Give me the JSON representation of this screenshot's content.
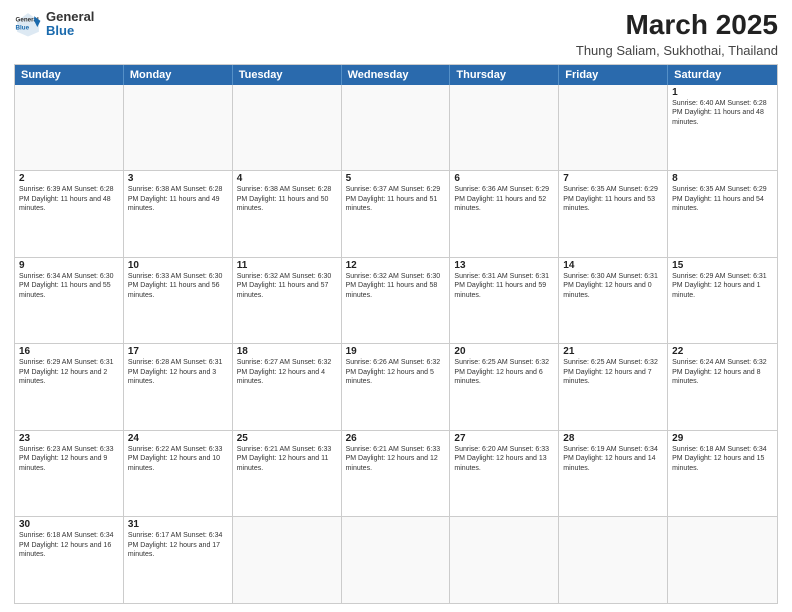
{
  "header": {
    "logo_general": "General",
    "logo_blue": "Blue",
    "main_title": "March 2025",
    "subtitle": "Thung Saliam, Sukhothai, Thailand"
  },
  "weekdays": [
    "Sunday",
    "Monday",
    "Tuesday",
    "Wednesday",
    "Thursday",
    "Friday",
    "Saturday"
  ],
  "rows": [
    [
      {
        "day": "",
        "info": ""
      },
      {
        "day": "",
        "info": ""
      },
      {
        "day": "",
        "info": ""
      },
      {
        "day": "",
        "info": ""
      },
      {
        "day": "",
        "info": ""
      },
      {
        "day": "",
        "info": ""
      },
      {
        "day": "1",
        "info": "Sunrise: 6:40 AM\nSunset: 6:28 PM\nDaylight: 11 hours and 48 minutes."
      }
    ],
    [
      {
        "day": "2",
        "info": "Sunrise: 6:39 AM\nSunset: 6:28 PM\nDaylight: 11 hours and 48 minutes."
      },
      {
        "day": "3",
        "info": "Sunrise: 6:38 AM\nSunset: 6:28 PM\nDaylight: 11 hours and 49 minutes."
      },
      {
        "day": "4",
        "info": "Sunrise: 6:38 AM\nSunset: 6:28 PM\nDaylight: 11 hours and 50 minutes."
      },
      {
        "day": "5",
        "info": "Sunrise: 6:37 AM\nSunset: 6:29 PM\nDaylight: 11 hours and 51 minutes."
      },
      {
        "day": "6",
        "info": "Sunrise: 6:36 AM\nSunset: 6:29 PM\nDaylight: 11 hours and 52 minutes."
      },
      {
        "day": "7",
        "info": "Sunrise: 6:35 AM\nSunset: 6:29 PM\nDaylight: 11 hours and 53 minutes."
      },
      {
        "day": "8",
        "info": "Sunrise: 6:35 AM\nSunset: 6:29 PM\nDaylight: 11 hours and 54 minutes."
      }
    ],
    [
      {
        "day": "9",
        "info": "Sunrise: 6:34 AM\nSunset: 6:30 PM\nDaylight: 11 hours and 55 minutes."
      },
      {
        "day": "10",
        "info": "Sunrise: 6:33 AM\nSunset: 6:30 PM\nDaylight: 11 hours and 56 minutes."
      },
      {
        "day": "11",
        "info": "Sunrise: 6:32 AM\nSunset: 6:30 PM\nDaylight: 11 hours and 57 minutes."
      },
      {
        "day": "12",
        "info": "Sunrise: 6:32 AM\nSunset: 6:30 PM\nDaylight: 11 hours and 58 minutes."
      },
      {
        "day": "13",
        "info": "Sunrise: 6:31 AM\nSunset: 6:31 PM\nDaylight: 11 hours and 59 minutes."
      },
      {
        "day": "14",
        "info": "Sunrise: 6:30 AM\nSunset: 6:31 PM\nDaylight: 12 hours and 0 minutes."
      },
      {
        "day": "15",
        "info": "Sunrise: 6:29 AM\nSunset: 6:31 PM\nDaylight: 12 hours and 1 minute."
      }
    ],
    [
      {
        "day": "16",
        "info": "Sunrise: 6:29 AM\nSunset: 6:31 PM\nDaylight: 12 hours and 2 minutes."
      },
      {
        "day": "17",
        "info": "Sunrise: 6:28 AM\nSunset: 6:31 PM\nDaylight: 12 hours and 3 minutes."
      },
      {
        "day": "18",
        "info": "Sunrise: 6:27 AM\nSunset: 6:32 PM\nDaylight: 12 hours and 4 minutes."
      },
      {
        "day": "19",
        "info": "Sunrise: 6:26 AM\nSunset: 6:32 PM\nDaylight: 12 hours and 5 minutes."
      },
      {
        "day": "20",
        "info": "Sunrise: 6:25 AM\nSunset: 6:32 PM\nDaylight: 12 hours and 6 minutes."
      },
      {
        "day": "21",
        "info": "Sunrise: 6:25 AM\nSunset: 6:32 PM\nDaylight: 12 hours and 7 minutes."
      },
      {
        "day": "22",
        "info": "Sunrise: 6:24 AM\nSunset: 6:32 PM\nDaylight: 12 hours and 8 minutes."
      }
    ],
    [
      {
        "day": "23",
        "info": "Sunrise: 6:23 AM\nSunset: 6:33 PM\nDaylight: 12 hours and 9 minutes."
      },
      {
        "day": "24",
        "info": "Sunrise: 6:22 AM\nSunset: 6:33 PM\nDaylight: 12 hours and 10 minutes."
      },
      {
        "day": "25",
        "info": "Sunrise: 6:21 AM\nSunset: 6:33 PM\nDaylight: 12 hours and 11 minutes."
      },
      {
        "day": "26",
        "info": "Sunrise: 6:21 AM\nSunset: 6:33 PM\nDaylight: 12 hours and 12 minutes."
      },
      {
        "day": "27",
        "info": "Sunrise: 6:20 AM\nSunset: 6:33 PM\nDaylight: 12 hours and 13 minutes."
      },
      {
        "day": "28",
        "info": "Sunrise: 6:19 AM\nSunset: 6:34 PM\nDaylight: 12 hours and 14 minutes."
      },
      {
        "day": "29",
        "info": "Sunrise: 6:18 AM\nSunset: 6:34 PM\nDaylight: 12 hours and 15 minutes."
      }
    ],
    [
      {
        "day": "30",
        "info": "Sunrise: 6:18 AM\nSunset: 6:34 PM\nDaylight: 12 hours and 16 minutes."
      },
      {
        "day": "31",
        "info": "Sunrise: 6:17 AM\nSunset: 6:34 PM\nDaylight: 12 hours and 17 minutes."
      },
      {
        "day": "",
        "info": ""
      },
      {
        "day": "",
        "info": ""
      },
      {
        "day": "",
        "info": ""
      },
      {
        "day": "",
        "info": ""
      },
      {
        "day": "",
        "info": ""
      }
    ]
  ]
}
